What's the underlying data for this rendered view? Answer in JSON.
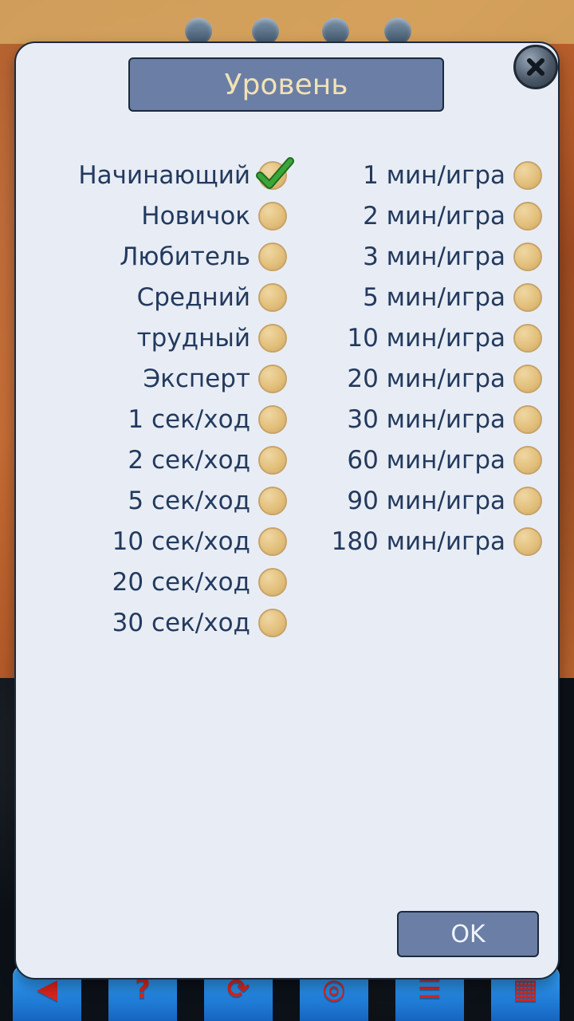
{
  "dialog": {
    "title": "Уровень",
    "ok_label": "OK",
    "close_icon": "close-icon"
  },
  "left_options": [
    {
      "label": "Начинающий",
      "selected": true
    },
    {
      "label": "Новичок",
      "selected": false
    },
    {
      "label": "Любитель",
      "selected": false
    },
    {
      "label": "Средний",
      "selected": false
    },
    {
      "label": "трудный",
      "selected": false
    },
    {
      "label": "Эксперт",
      "selected": false
    },
    {
      "label": "1 сек/ход",
      "selected": false
    },
    {
      "label": "2 сек/ход",
      "selected": false
    },
    {
      "label": "5 сек/ход",
      "selected": false
    },
    {
      "label": "10 сек/ход",
      "selected": false
    },
    {
      "label": "20 сек/ход",
      "selected": false
    },
    {
      "label": "30 сек/ход",
      "selected": false
    }
  ],
  "right_options": [
    {
      "label": "1 мин/игра",
      "selected": false
    },
    {
      "label": "2 мин/игра",
      "selected": false
    },
    {
      "label": "3 мин/игра",
      "selected": false
    },
    {
      "label": "5 мин/игра",
      "selected": false
    },
    {
      "label": "10 мин/игра",
      "selected": false
    },
    {
      "label": "20 мин/игра",
      "selected": false
    },
    {
      "label": "30 мин/игра",
      "selected": false
    },
    {
      "label": "60 мин/игра",
      "selected": false
    },
    {
      "label": "90 мин/игра",
      "selected": false
    },
    {
      "label": "180 мин/игра",
      "selected": false
    }
  ],
  "toolbar": {
    "buttons": [
      {
        "icon": "back-arrow-icon"
      },
      {
        "icon": "help-icon"
      },
      {
        "icon": "rotate-icon"
      },
      {
        "icon": "eye-icon"
      },
      {
        "icon": "menu-icon"
      },
      {
        "icon": "level-icon"
      }
    ]
  },
  "colors": {
    "dialog_bg": "#e8edf5",
    "title_bg": "#6b7ea5",
    "title_text": "#f1e2b7",
    "label_text": "#233a5e",
    "radio": "#e3c07c",
    "check": "#3aa63a"
  }
}
